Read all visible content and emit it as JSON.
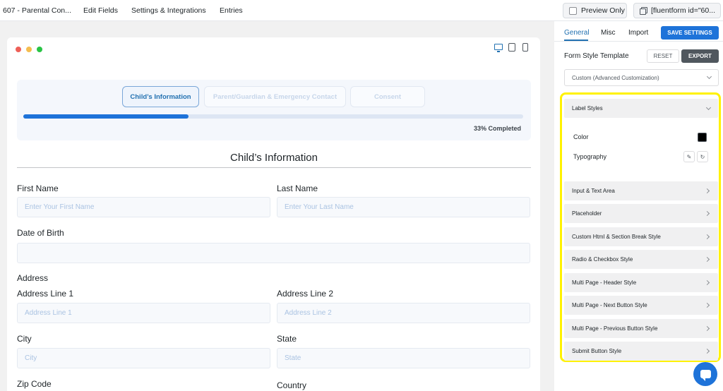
{
  "topbar": {
    "form_title": "607 - Parental Con...",
    "nav": [
      "Edit Fields",
      "Settings & Integrations",
      "Entries"
    ],
    "preview_label": "Preview Only",
    "shortcode": "[fluentform id=\"60..."
  },
  "canvas": {
    "steps": [
      "Child’s Information",
      "Parent/Guardian & Emergency Contact",
      "Consent"
    ],
    "progress_percent": 33,
    "progress_text": "33% Completed",
    "section_title": "Child’s Information",
    "fields": {
      "first_name_label": "First Name",
      "first_name_placeholder": "Enter Your First Name",
      "last_name_label": "Last Name",
      "last_name_placeholder": "Enter Your Last Name",
      "dob_label": "Date of Birth",
      "address_label": "Address",
      "address1_label": "Address Line 1",
      "address1_placeholder": "Address Line 1",
      "address2_label": "Address Line 2",
      "address2_placeholder": "Address Line 2",
      "city_label": "City",
      "city_placeholder": "City",
      "state_label": "State",
      "state_placeholder": "State",
      "zip_label": "Zip Code",
      "country_label": "Country"
    }
  },
  "sidebar": {
    "tabs": [
      "General",
      "Misc",
      "Import"
    ],
    "active_tab": "General",
    "save_label": "SAVE SETTINGS",
    "form_style_label": "Form Style Template",
    "reset_label": "RESET",
    "export_label": "EXPORT",
    "template_value": "Custom (Advanced Customization)",
    "label_styles": {
      "title": "Label Styles",
      "color_label": "Color",
      "color_value": "#000000",
      "typography_label": "Typography"
    },
    "sections": [
      "Input & Text Area",
      "Placeholder",
      "Custom Html & Section Break Style",
      "Radio & Checkbox Style",
      "Multi Page - Header Style",
      "Multi Page - Next Button Style",
      "Multi Page - Previous Button Style",
      "Submit Button Style"
    ]
  },
  "colors": {
    "accent": "#1e73d9",
    "highlight": "#fff200"
  }
}
